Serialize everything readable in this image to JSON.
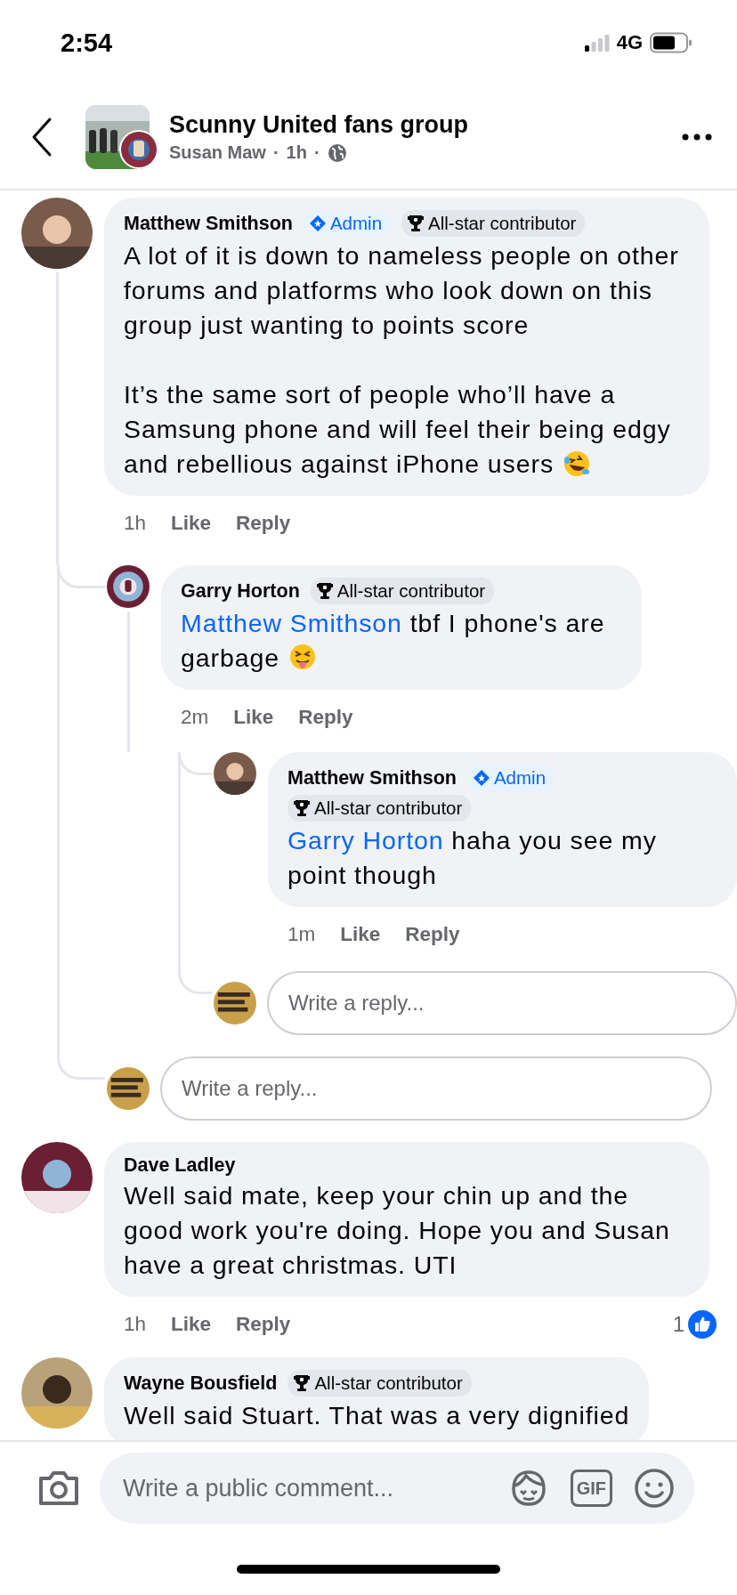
{
  "status_bar": {
    "time": "2:54",
    "network": "4G"
  },
  "header": {
    "title": "Scunny United fans group",
    "author": "Susan Maw",
    "separator": "·",
    "time": "1h"
  },
  "comments": [
    {
      "kind": "comment",
      "author": "Matthew Smithson",
      "badges": [
        {
          "kind": "admin",
          "label": "Admin"
        },
        {
          "kind": "allstar",
          "label": "All-star contributor"
        }
      ],
      "paragraphs": [
        "A lot of it is down to nameless people on other forums and platforms who look down on this group just wanting to points score",
        "It’s the same sort of people who’ll have a Samsung phone and will feel their being edgy and rebellious against iPhone users"
      ],
      "emoji": {
        "kind": "laughing"
      },
      "time": "1h",
      "like": "Like",
      "reply": "Reply",
      "children": [
        {
          "kind": "comment",
          "author": "Garry Horton",
          "badges": [
            {
              "kind": "allstar",
              "label": "All-star contributor"
            }
          ],
          "mention": "Matthew Smithson",
          "paragraphs": [
            "tbf I phone's are garbage"
          ],
          "emoji": {
            "kind": "tongue"
          },
          "time": "2m",
          "like": "Like",
          "reply": "Reply",
          "children": [
            {
              "kind": "comment",
              "author": "Matthew Smithson",
              "badges": [
                {
                  "kind": "admin",
                  "label": "Admin"
                },
                {
                  "kind": "allstar",
                  "label": "All-star contributor"
                }
              ],
              "mention": "Garry Horton",
              "paragraphs": [
                "haha you see my point though"
              ],
              "time": "1m",
              "like": "Like",
              "reply": "Reply"
            },
            {
              "kind": "reply_box",
              "placeholder": "Write a reply..."
            }
          ]
        },
        {
          "kind": "reply_box",
          "placeholder": "Write a reply..."
        }
      ]
    },
    {
      "kind": "comment",
      "author": "Dave Ladley",
      "paragraphs": [
        "Well said mate, keep your chin up and the good work you're doing. Hope you and Susan have a great christmas. UTI"
      ],
      "time": "1h",
      "like": "Like",
      "reply": "Reply",
      "reaction_count": "1"
    },
    {
      "kind": "comment",
      "author": "Wayne Bousfield",
      "badges": [
        {
          "kind": "allstar",
          "label": "All-star contributor"
        }
      ],
      "paragraphs": [
        "Well said Stuart. That was a very dignified"
      ]
    }
  ],
  "composer": {
    "placeholder": "Write a public comment...",
    "gif_label": "GIF"
  }
}
